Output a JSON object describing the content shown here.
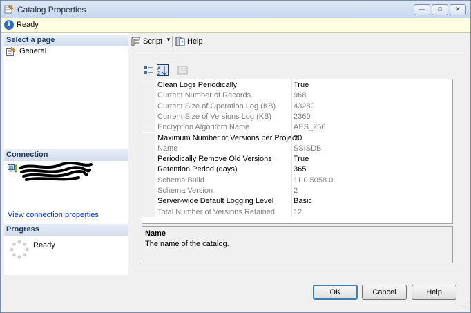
{
  "window": {
    "title": "Catalog Properties",
    "caption_buttons": {
      "minimize": "—",
      "maximize": "□",
      "close": "✕"
    }
  },
  "status": {
    "text": "Ready",
    "icon": "info-icon"
  },
  "select_page": {
    "header": "Select a page",
    "items": [
      {
        "label": "General",
        "icon": "properties-page-icon"
      }
    ]
  },
  "connection": {
    "header": "Connection",
    "server_icon": "server-icon",
    "view_link": "View connection properties"
  },
  "progress": {
    "header": "Progress",
    "status": "Ready",
    "icon": "spinner-icon"
  },
  "toolbar": {
    "script_label": "Script",
    "help_label": "Help"
  },
  "property_grid": {
    "rows": [
      {
        "name": "Clean Logs Periodically",
        "value": "True",
        "readonly": false
      },
      {
        "name": "Current Number of Records",
        "value": "968",
        "readonly": true
      },
      {
        "name": "Current Size of Operation Log (KB)",
        "value": "43280",
        "readonly": true
      },
      {
        "name": "Current Size of Versions Log (KB)",
        "value": "2360",
        "readonly": true
      },
      {
        "name": "Encryption Algorithm Name",
        "value": "AES_256",
        "readonly": true
      },
      {
        "name": "Maximum Number of Versions per Project",
        "value": "10",
        "readonly": false
      },
      {
        "name": "Name",
        "value": "SSISDB",
        "readonly": true
      },
      {
        "name": "Periodically Remove Old Versions",
        "value": "True",
        "readonly": false
      },
      {
        "name": "Retention Period (days)",
        "value": "365",
        "readonly": false
      },
      {
        "name": "Schema Build",
        "value": "11.0.5058.0",
        "readonly": true
      },
      {
        "name": "Schema Version",
        "value": "2",
        "readonly": true
      },
      {
        "name": "Server-wide Default Logging Level",
        "value": "Basic",
        "readonly": false
      },
      {
        "name": "Total Number of Versions Retained",
        "value": "12",
        "readonly": true
      }
    ]
  },
  "description": {
    "title": "Name",
    "text": "The name of the catalog."
  },
  "buttons": {
    "ok": "OK",
    "cancel": "Cancel",
    "help": "Help"
  },
  "colors": {
    "status_bar": "#ffffe1",
    "link": "#0033cc",
    "readonly_text": "#808080",
    "default_button_border": "#3c7fb1"
  }
}
